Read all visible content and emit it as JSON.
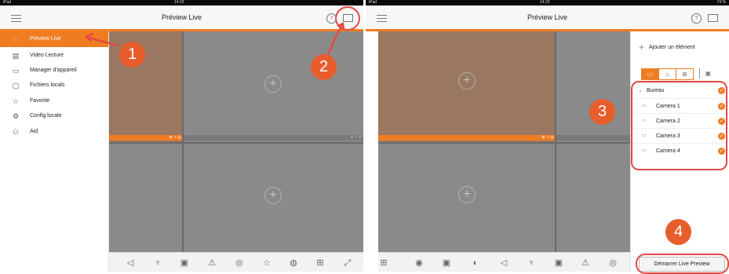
{
  "status": {
    "device": "iPad",
    "time": "14:23",
    "battery": "74 %"
  },
  "header": {
    "title": "Préview Live"
  },
  "sidebar": {
    "items": [
      {
        "label": "Préview Live",
        "icon": "preview-icon",
        "glyph": "◌"
      },
      {
        "label": "Video Lecture",
        "icon": "video-lecture-icon",
        "glyph": "▤"
      },
      {
        "label": "Manager d'appareil",
        "icon": "device-manager-icon",
        "glyph": "▭"
      },
      {
        "label": "Fichiers locals",
        "icon": "folder-icon",
        "glyph": "▢"
      },
      {
        "label": "Favorite",
        "icon": "star-icon",
        "glyph": "☆"
      },
      {
        "label": "Config locale",
        "icon": "gear-icon",
        "glyph": "⚙"
      },
      {
        "label": "Aid",
        "icon": "user-icon",
        "glyph": "⚇"
      }
    ]
  },
  "right_panel": {
    "add_label": "Ajouter un élément",
    "group": "Bureau",
    "cameras": [
      "Camera 1",
      "Camera 2",
      "Camera 3",
      "Camera 4"
    ],
    "start_button": "Démarrer Live Preview"
  },
  "badges": [
    "1",
    "2",
    "3",
    "4"
  ],
  "help_glyph": "?",
  "plus_glyph": "+",
  "colors": {
    "accent": "#f07c22",
    "annotation": "#e24a45",
    "grid": "#696969"
  },
  "left_toolbar": [
    {
      "icon": "sound-icon",
      "glyph": "◁"
    },
    {
      "icon": "microphone-icon",
      "glyph": "♆"
    },
    {
      "icon": "snapshot-icon",
      "glyph": "▣"
    },
    {
      "icon": "alert-icon",
      "glyph": "⚠"
    },
    {
      "icon": "ptz-icon",
      "glyph": "◎"
    },
    {
      "icon": "favorite-icon",
      "glyph": "☆"
    },
    {
      "icon": "palette-icon",
      "glyph": "◍"
    },
    {
      "icon": "layout-icon",
      "glyph": "⊞"
    },
    {
      "icon": "fullscreen-icon",
      "glyph": "⤢"
    }
  ],
  "right_toolbar": [
    {
      "icon": "layout-icon",
      "glyph": "⊞"
    },
    {
      "icon": "camera-icon",
      "glyph": "◉"
    },
    {
      "icon": "record-icon",
      "glyph": "▣"
    },
    {
      "icon": "playback-icon",
      "glyph": "◐"
    },
    {
      "icon": "sound-icon",
      "glyph": "◁"
    },
    {
      "icon": "microphone-icon",
      "glyph": "♆"
    },
    {
      "icon": "snapshot-icon",
      "glyph": "▣"
    },
    {
      "icon": "alert-icon",
      "glyph": "⚠"
    },
    {
      "icon": "ptz-icon",
      "glyph": "◎"
    }
  ]
}
